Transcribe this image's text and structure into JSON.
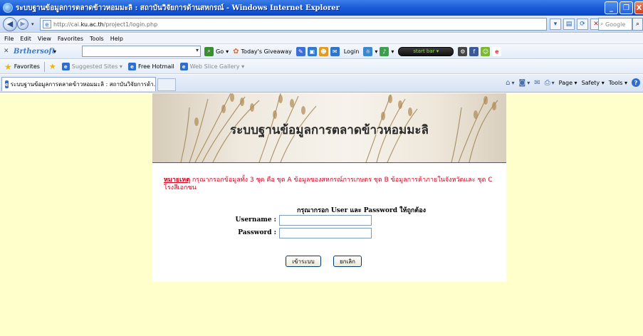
{
  "window": {
    "title": "ระบบฐานข้อมูลการตลาดข้าวหอมมะลิ : สถาบันวิจัยการด้านสหกรณ์ - Windows Internet Explorer",
    "min_label": "_",
    "max_label": "❐",
    "close_label": "X"
  },
  "address": {
    "url_prefix": "http://cai.",
    "url_domain": "ku.ac.th",
    "url_path": "/project1/login.php",
    "search_placeholder": "Google"
  },
  "menu": {
    "items": [
      "File",
      "Edit",
      "View",
      "Favorites",
      "Tools",
      "Help"
    ]
  },
  "toolbar": {
    "brand_left": "Br",
    "brand_right": "thersoft",
    "go_label": "Go",
    "giveaway_label": "Today's Giveaway",
    "login_label": "Login",
    "toggle_label": "start bar ▾"
  },
  "favorites": {
    "label": "Favorites",
    "links": [
      "Suggested Sites ▾",
      "Free Hotmail",
      "Web Slice Gallery ▾"
    ]
  },
  "tab": {
    "title": "ระบบฐานข้อมูลการตลาดข้าวหอมมะลิ : สถาบันวิจัยการด้า..."
  },
  "commandbar": {
    "page_label": "Page ▾",
    "safety_label": "Safety ▾",
    "tools_label": "Tools ▾",
    "help_label": "?"
  },
  "page": {
    "banner_title": "ระบบฐานข้อมูลการตลาดข้าวหอมมะลิ",
    "note_label": "หมายเหตุ",
    "note_text": " กรุณากรอกข้อมูลทั้ง 3 ชุด คือ ชุด A ข้อมูลของสหกรณ์การเกษตร ชุด B ข้อมูลการค้าภายในจังหวัดและ ชุด C โรงสีเอกชน",
    "prompt": "กรุณากรอก User และ Password ให้ถูกต้อง",
    "username_label": "Username :",
    "password_label": "Password :",
    "username_value": "",
    "password_value": "",
    "login_button": "เข้าระบบ",
    "cancel_button": "ยกเลิก"
  },
  "colors": {
    "page_background": "#ffffcc",
    "note_text": "#d8001c",
    "titlebar": "#1d5fd8"
  }
}
